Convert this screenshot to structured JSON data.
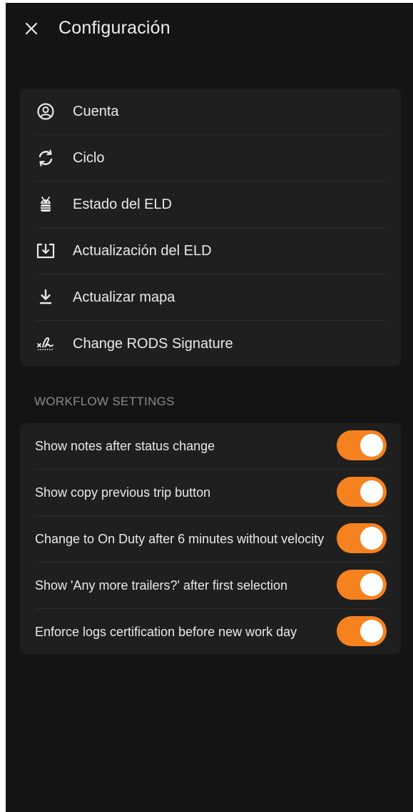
{
  "header": {
    "title": "Configuración",
    "close_icon": "close-icon"
  },
  "menu": {
    "items": [
      {
        "icon": "account-circle-icon",
        "label": "Cuenta"
      },
      {
        "icon": "cycle-icon",
        "label": "Ciclo"
      },
      {
        "icon": "android-device-icon",
        "label": "Estado del ELD"
      },
      {
        "icon": "download-box-icon",
        "label": "Actualización del ELD"
      },
      {
        "icon": "download-map-icon",
        "label": "Actualizar mapa"
      },
      {
        "icon": "signature-icon",
        "label": "Change RODS Signature"
      }
    ]
  },
  "workflow": {
    "section_title": "WORKFLOW SETTINGS",
    "settings": [
      {
        "label": "Show notes after status change",
        "enabled": true
      },
      {
        "label": "Show copy previous trip button",
        "enabled": true
      },
      {
        "label": "Change to On Duty after 6 minutes without velocity",
        "enabled": true
      },
      {
        "label": "Show 'Any more trailers?' after first selection",
        "enabled": true
      },
      {
        "label": "Enforce logs certification before new work day",
        "enabled": true
      }
    ]
  },
  "colors": {
    "background": "#141414",
    "card": "#1f1f1f",
    "accent": "#f5821f",
    "text": "#e9e9e9",
    "muted": "#8a8a8a"
  }
}
